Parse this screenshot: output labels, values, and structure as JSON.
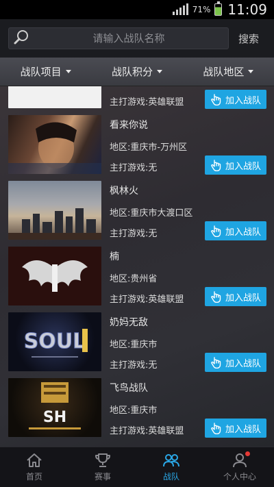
{
  "status_bar": {
    "battery_percent": "71%",
    "time": "11:09"
  },
  "search": {
    "placeholder": "请输入战队名称",
    "button_label": "搜索"
  },
  "filters": [
    {
      "label": "战队项目"
    },
    {
      "label": "战队积分"
    },
    {
      "label": "战队地区"
    }
  ],
  "teams": [
    {
      "name": "",
      "region": "",
      "game": "主打游戏:英雄联盟",
      "join_label": "加入战队"
    },
    {
      "name": "看来你说",
      "region": "地区:重庆市-万州区",
      "game": "主打游戏:无",
      "join_label": "加入战队"
    },
    {
      "name": "枫林火",
      "region": "地区:重庆市大渡口区",
      "game": "主打游戏:无",
      "join_label": "加入战队"
    },
    {
      "name": "楠",
      "region": "地区:贵州省",
      "game": "主打游戏:英雄联盟",
      "join_label": "加入战队"
    },
    {
      "name": "奶妈无敌",
      "region": "地区:重庆市",
      "game": "主打游戏:无",
      "join_label": "加入战队"
    },
    {
      "name": "飞鸟战队",
      "region": "地区:重庆市",
      "game": "主打游戏:英雄联盟",
      "join_label": "加入战队"
    }
  ],
  "tabs": [
    {
      "label": "首页",
      "icon": "home-icon",
      "active": false
    },
    {
      "label": "赛事",
      "icon": "trophy-icon",
      "active": false
    },
    {
      "label": "战队",
      "icon": "team-icon",
      "active": true
    },
    {
      "label": "个人中心",
      "icon": "person-icon",
      "active": false
    }
  ],
  "colors": {
    "accent": "#1fa5e2",
    "notification_dot": "#e53935"
  }
}
